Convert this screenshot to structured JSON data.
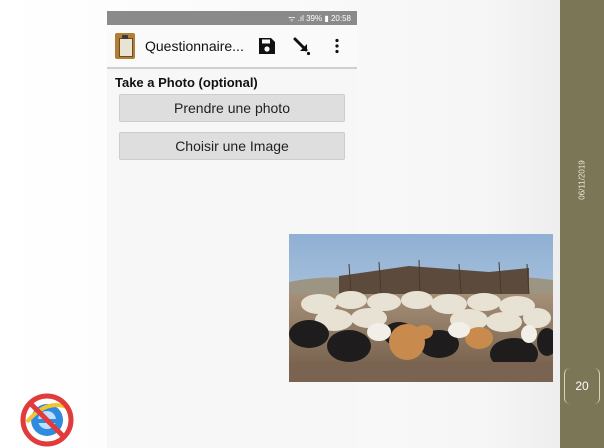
{
  "slide": {
    "date": "06/11/2019",
    "page_number": "20"
  },
  "phone": {
    "status_bar": "ᯤ .ıl 39% ▮ 20:58",
    "app_title": "Questionnaire...",
    "icons": [
      "clipboard-icon",
      "save-icon",
      "send-arrow-icon",
      "more-vert-icon"
    ],
    "question_label": "Take a Photo (optional)",
    "buttons": {
      "take_photo": "Prendre une photo",
      "choose_image": "Choisir une Image"
    }
  },
  "colors": {
    "side_band": "#7b7656",
    "status_bar": "#8a8a8a",
    "no_ie_red": "#e23b3b",
    "ie_blue": "#2f8be0"
  }
}
